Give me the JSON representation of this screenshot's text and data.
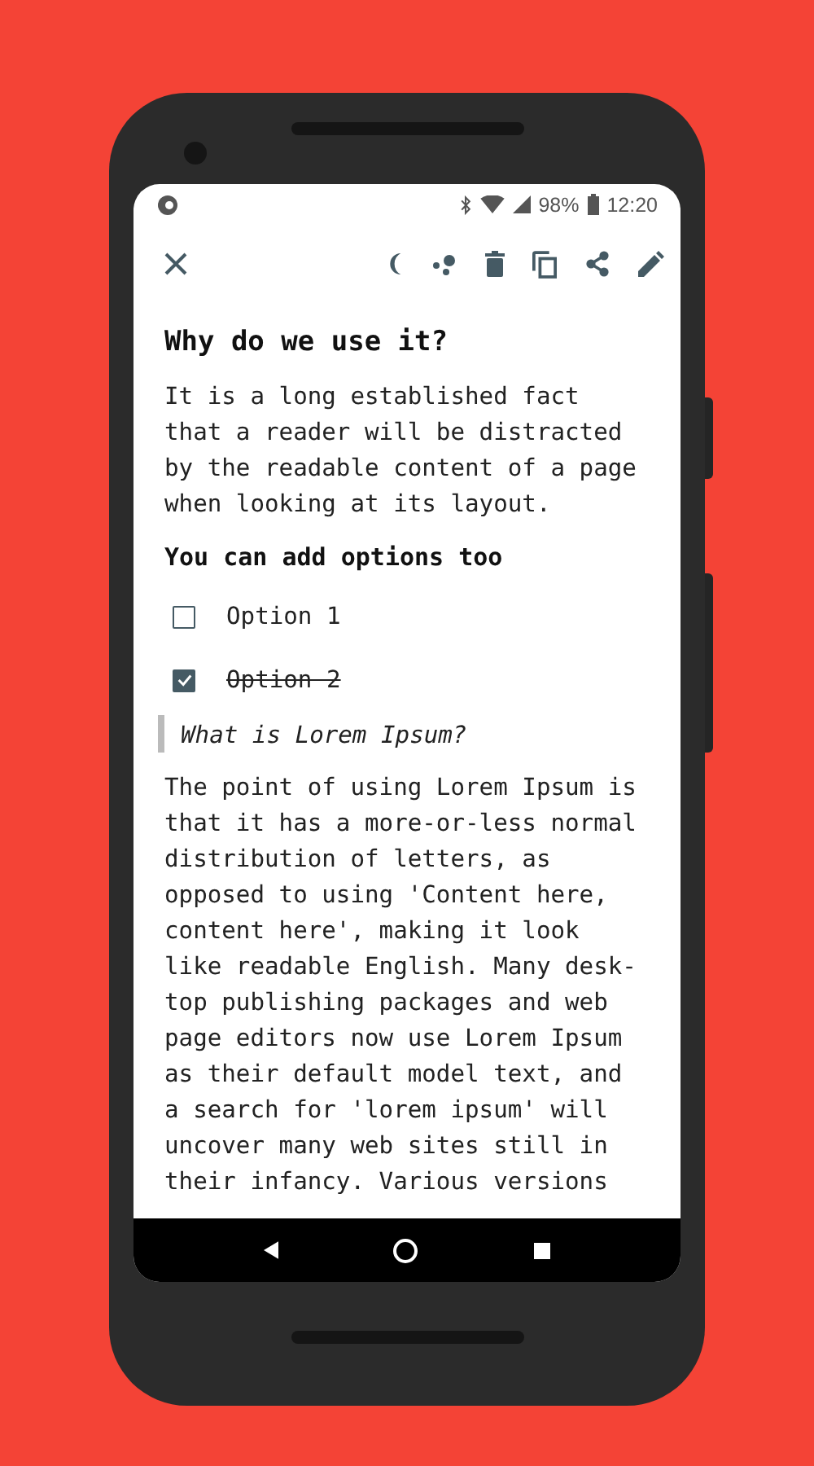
{
  "status_bar": {
    "battery": "98%",
    "time": "12:20"
  },
  "note": {
    "title": "Why do we use it?",
    "intro": "It is a long established fact that a reader will be distracted by the readable content of a page when looking at its layout.",
    "subtitle": "You can add options too",
    "options": [
      {
        "label": "Option 1",
        "checked": false
      },
      {
        "label": "Option 2",
        "checked": true
      }
    ],
    "quote": "What is Lorem Ipsum?",
    "body": "The point of using Lorem Ipsum is that it has a more-or-less normal distribution of letters, as opposed to using 'Content here, content here', making it look like readable English. Many desk-top publishing packages and web page editors now use Lorem Ipsum as their default model text, and a search for 'lorem ipsum' will uncover many web sites still in their infancy. Various versions"
  }
}
